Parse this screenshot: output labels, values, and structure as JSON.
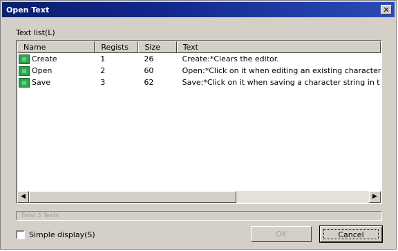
{
  "window": {
    "title": "Open Text",
    "close_label": "✕"
  },
  "list": {
    "label": "Text list(L)",
    "columns": [
      {
        "label": "Name"
      },
      {
        "label": "Regists"
      },
      {
        "label": "Size"
      },
      {
        "label": "Text"
      }
    ],
    "rows": [
      {
        "name": "Create",
        "reg": "1",
        "size": "26",
        "text": "Create:*Clears the editor."
      },
      {
        "name": "Open",
        "reg": "2",
        "size": "60",
        "text": "Open:*Click on it when editing an existing character"
      },
      {
        "name": "Save",
        "reg": "3",
        "size": "62",
        "text": "Save:*Click on it when saving a character string in t"
      }
    ]
  },
  "status_text": "Total 3 Texts",
  "simple_display_label": "Simple display(S)",
  "buttons": {
    "ok": "OK",
    "cancel": "Cancel"
  },
  "icons": {
    "row_icon": "text-document-icon",
    "close": "close-icon"
  }
}
